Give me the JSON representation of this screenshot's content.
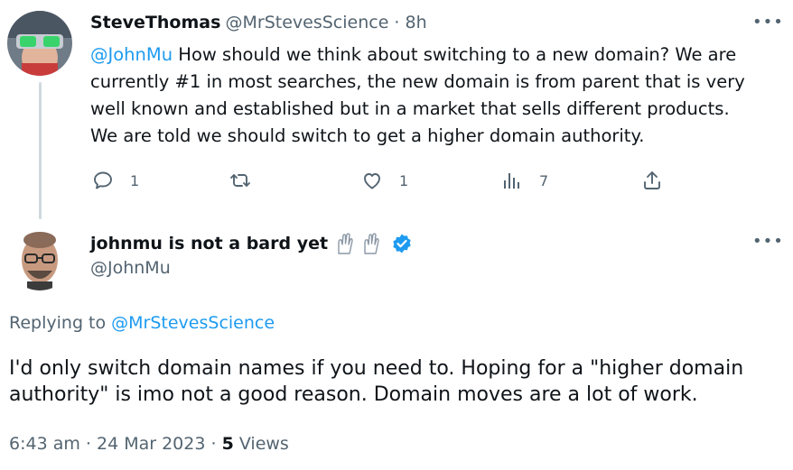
{
  "first_tweet": {
    "display_name": "SteveThomas",
    "handle": "@MrStevesScience",
    "separator": " · ",
    "time_ago": "8h",
    "mention": "@JohnMu",
    "text_lines": [
      " How should we think about switching to a new domain? We are",
      "currently #1 in most searches, the new domain is from parent that is very",
      "well known and established but in a market that sells different products.",
      "We are told we should switch to get a higher domain authority."
    ],
    "actions": {
      "reply_count": "1",
      "retweet_count": "",
      "like_count": "1",
      "views_count": "7"
    }
  },
  "reply_tweet": {
    "display_name": "johnmu is not a bard yet",
    "handle": "@JohnMu",
    "replying_to_prefix": "Replying to ",
    "replying_to_handle": "@MrStevesScience",
    "text_lines": [
      "I'd only switch domain names if you need to. Hoping for a \"higher domain",
      "authority\" is imo not a good reason. Domain moves are a lot of work."
    ],
    "timestamp": "6:43 am · 24 Mar 2023 · ",
    "views_number": "5",
    "views_label": " Views"
  },
  "colors": {
    "accent": "#1d9bf0",
    "secondary_text": "#536471",
    "primary_text": "#0f1419",
    "thread_line": "#cfd9de"
  },
  "icons": [
    "reply-icon",
    "retweet-icon",
    "like-icon",
    "views-icon",
    "share-icon",
    "more-icon",
    "verified-badge-icon",
    "clapping-hands-icon"
  ]
}
